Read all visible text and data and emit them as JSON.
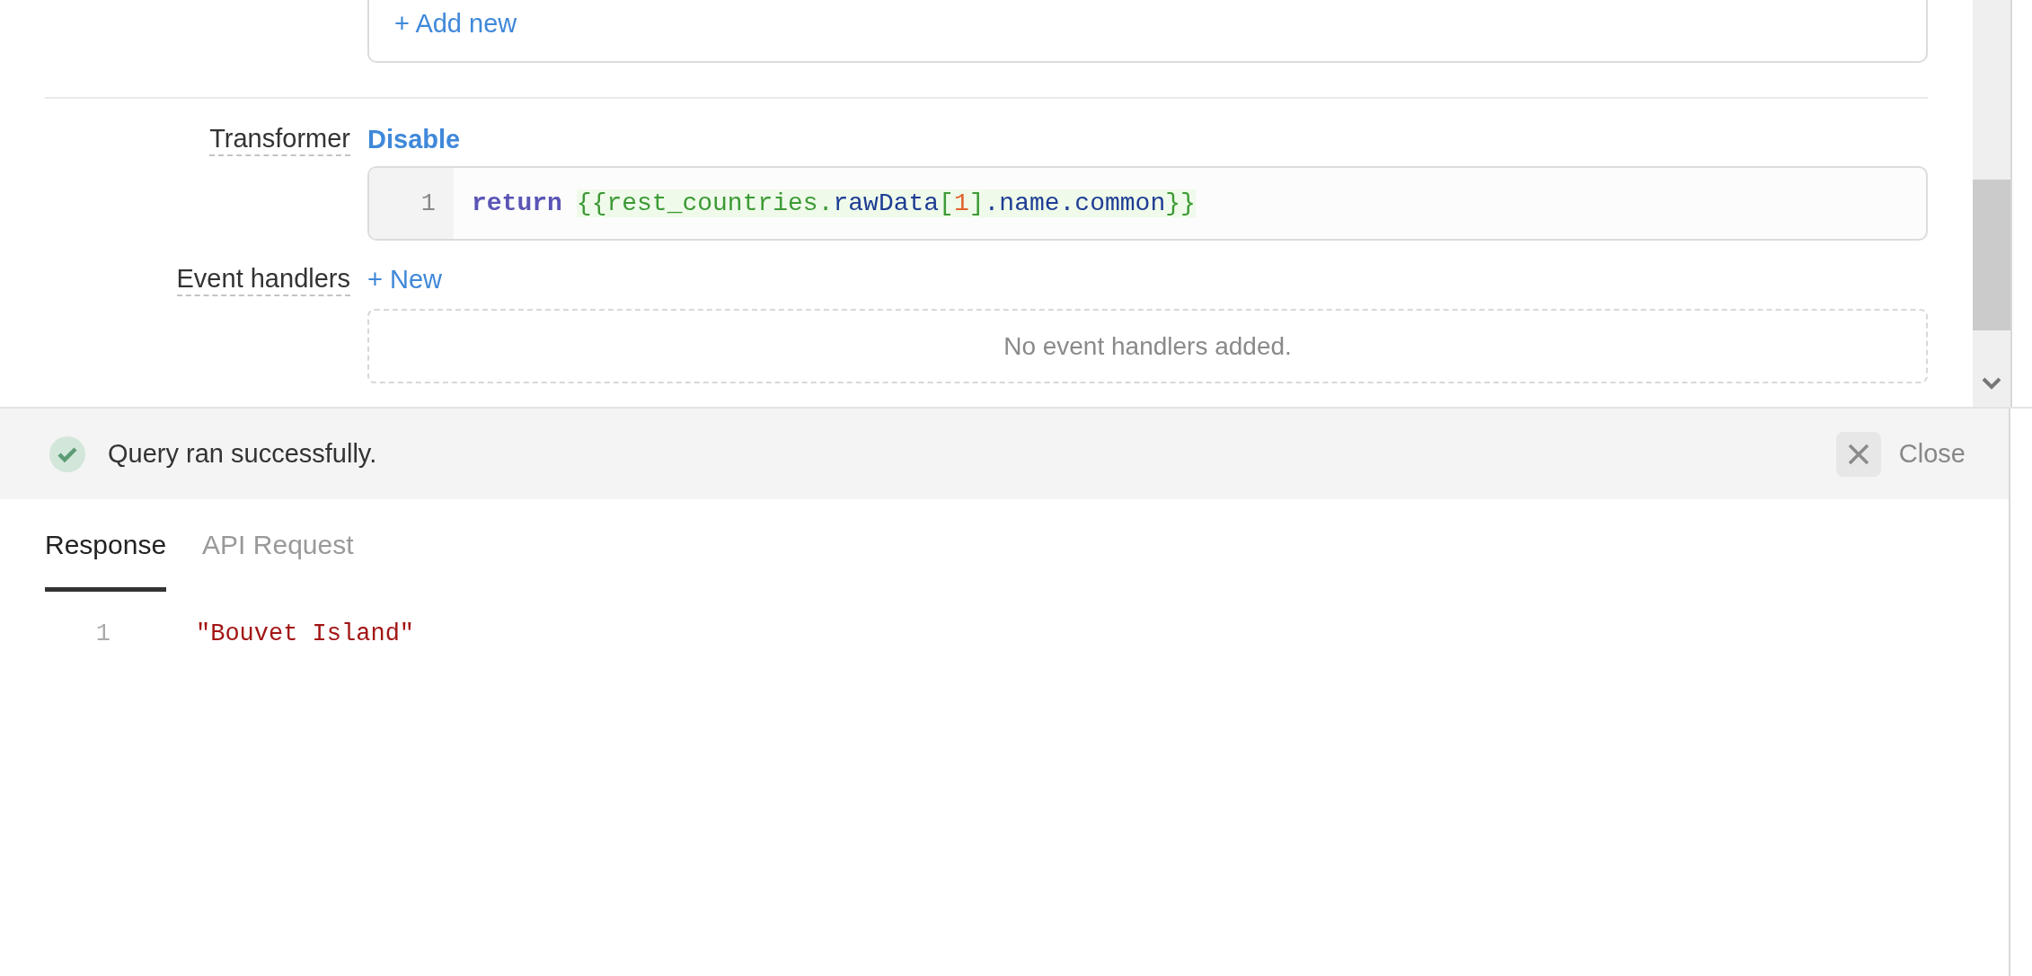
{
  "add_new_link": "+ Add new",
  "transformer": {
    "label": "Transformer",
    "toggle_link": "Disable",
    "editor": {
      "line_number": "1",
      "keyword": "return",
      "expression": [
        {
          "kind": "template",
          "text": "{{rest_countries."
        },
        {
          "kind": "property",
          "text": "rawData"
        },
        {
          "kind": "template",
          "text": "["
        },
        {
          "kind": "number",
          "text": "1"
        },
        {
          "kind": "template",
          "text": "]"
        },
        {
          "kind": "property",
          "text": ".name.common"
        },
        {
          "kind": "template",
          "text": "}}"
        }
      ]
    }
  },
  "event_handlers": {
    "label": "Event handlers",
    "add_link": "+ New",
    "empty_message": "No event handlers added."
  },
  "status_bar": {
    "succeeded": true,
    "message": "Query ran successfully.",
    "close_label": "Close"
  },
  "tabs": [
    {
      "label": "Response",
      "selected": true
    },
    {
      "label": "API Request",
      "selected": false
    }
  ],
  "response": {
    "lines": [
      {
        "number": "1",
        "kind": "string",
        "text": "\"Bouvet Island\""
      }
    ]
  }
}
